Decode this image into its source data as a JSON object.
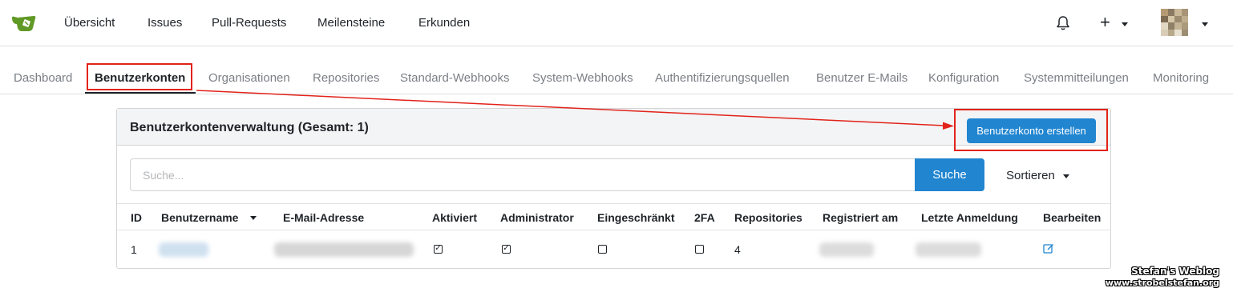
{
  "nav": {
    "items": [
      "Übersicht",
      "Issues",
      "Pull-Requests",
      "Meilensteine",
      "Erkunden"
    ],
    "plus": "+"
  },
  "admin_tabs": [
    "Dashboard",
    "Benutzerkonten",
    "Organisationen",
    "Repositories",
    "Standard-Webhooks",
    "System-Webhooks",
    "Authentifizierungsquellen",
    "Benutzer E-Mails",
    "Konfiguration",
    "Systemmitteilungen",
    "Monitoring"
  ],
  "active_tab": "Benutzerkonten",
  "panel": {
    "title": "Benutzerkontenverwaltung (Gesamt: 1)",
    "create_button": "Benutzerkonto erstellen",
    "search_placeholder": "Suche...",
    "search_button": "Suche",
    "sort_label": "Sortieren"
  },
  "table": {
    "headers": [
      "ID",
      "Benutzername",
      "E-Mail-Adresse",
      "Aktiviert",
      "Administrator",
      "Eingeschränkt",
      "2FA",
      "Repositories",
      "Registriert am",
      "Letzte Anmeldung",
      "Bearbeiten"
    ],
    "rows": [
      {
        "id": "1",
        "activated": true,
        "admin": true,
        "restricted": false,
        "twofa": false,
        "repositories": "4"
      }
    ]
  },
  "colors": {
    "primary": "#2185d0",
    "highlight": "#e2231a",
    "logo": "#609926"
  },
  "icons": [
    "gitea-logo-icon",
    "bell-icon",
    "plus-icon",
    "avatar",
    "edit-icon",
    "checkbox-icon"
  ],
  "watermark": {
    "line1": "Stefan's Weblog",
    "line2": "www.strobelstefan.org"
  }
}
